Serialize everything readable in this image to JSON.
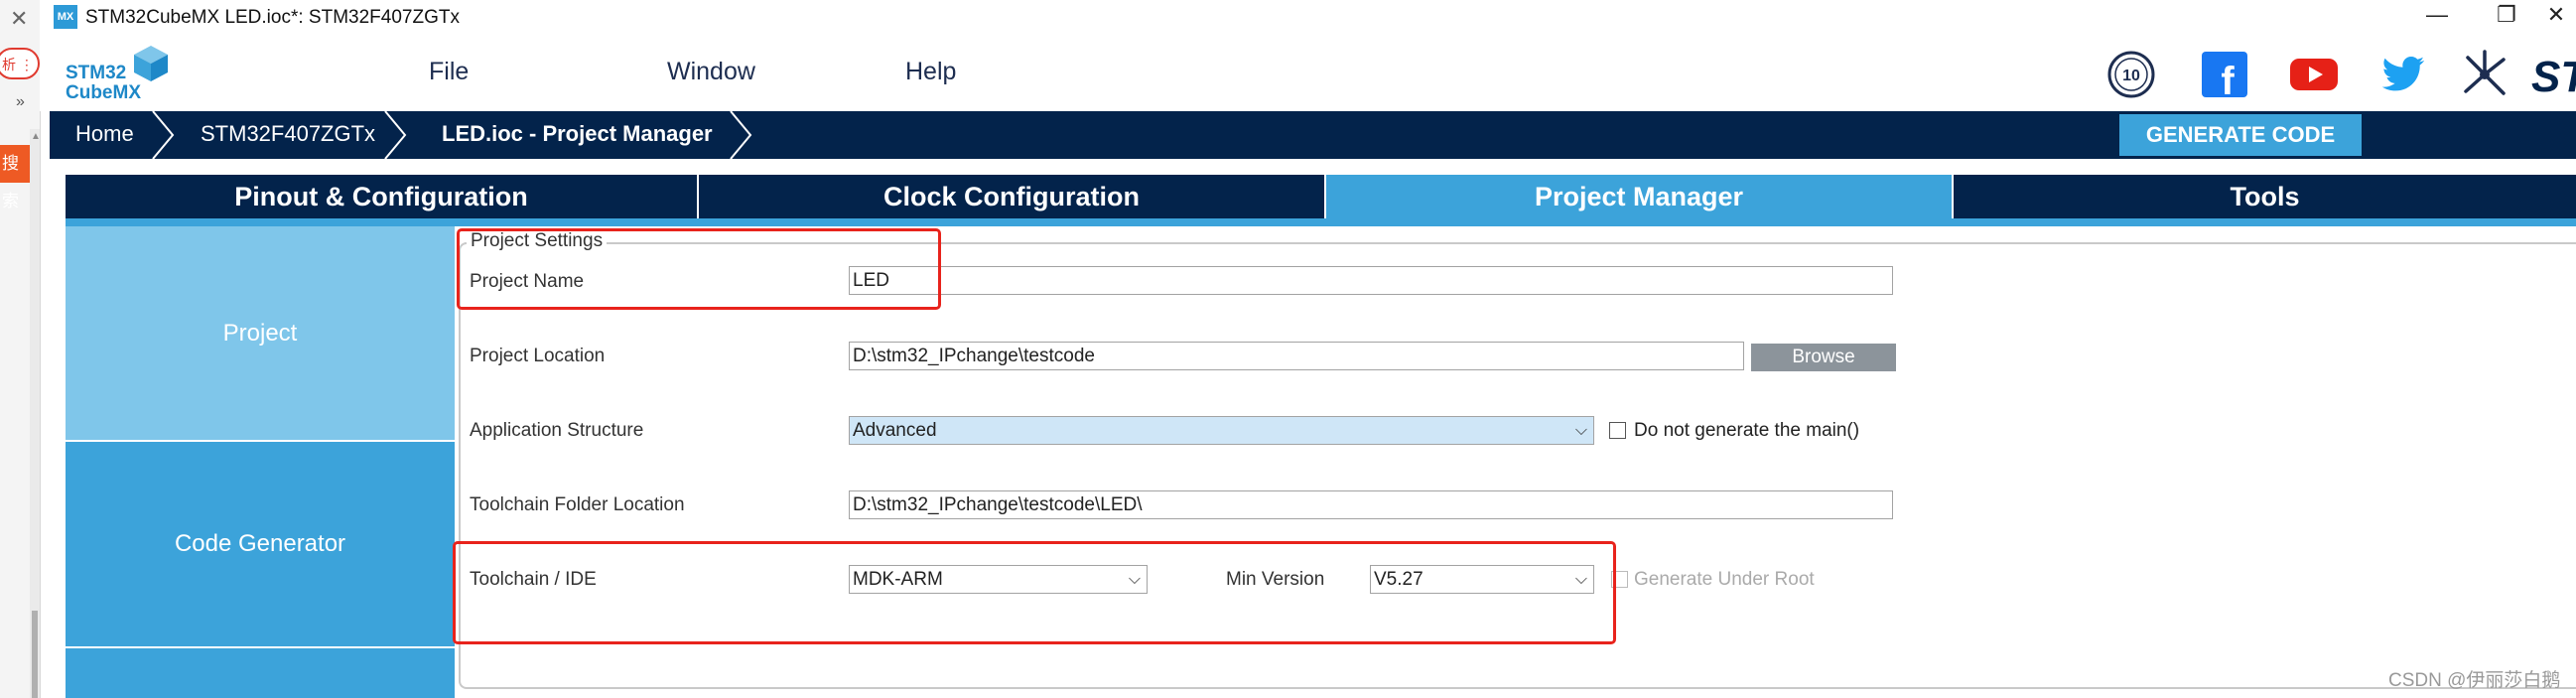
{
  "left_strip": {
    "close_glyph": "✕",
    "pill_text": "析 ⋮",
    "chevron_glyph": "»",
    "search_button": "搜索",
    "scroll_up_glyph": "▲"
  },
  "window": {
    "icon_text": "MX",
    "title": "STM32CubeMX LED.ioc*: STM32F407ZGTx",
    "minimize_glyph": "—",
    "restore_glyph": "❐",
    "close_glyph": "✕"
  },
  "logo": {
    "line1": "STM32",
    "line2": "CubeMX"
  },
  "menu": [
    {
      "label": "File"
    },
    {
      "label": "Window"
    },
    {
      "label": "Help"
    }
  ],
  "social_icons": [
    "anniversary-10-icon",
    "facebook-icon",
    "youtube-icon",
    "twitter-icon",
    "network-icon",
    "st-logo-icon"
  ],
  "social_text": {
    "badge": "10",
    "facebook": "f",
    "st": "ST"
  },
  "breadcrumb": [
    {
      "label": "Home"
    },
    {
      "label": "STM32F407ZGTx"
    },
    {
      "label": "LED.ioc - Project Manager"
    }
  ],
  "generate_button": "GENERATE CODE",
  "tabs": [
    {
      "label": "Pinout & Configuration",
      "active": false
    },
    {
      "label": "Clock Configuration",
      "active": false
    },
    {
      "label": "Project Manager",
      "active": true
    },
    {
      "label": "Tools",
      "active": false
    }
  ],
  "nav": [
    {
      "label": "Project"
    },
    {
      "label": "Code Generator"
    }
  ],
  "project_settings": {
    "legend": "Project Settings",
    "project_name_label": "Project Name",
    "project_name_value": "LED",
    "location_label": "Project Location",
    "location_value": "D:\\stm32_IPchange\\testcode",
    "browse_label": "Browse",
    "app_structure_label": "Application Structure",
    "app_structure_value": "Advanced",
    "no_main_label": "Do not generate the main()",
    "toolchain_folder_label": "Toolchain Folder Location",
    "toolchain_folder_value": "D:\\stm32_IPchange\\testcode\\LED\\",
    "toolchain_label": "Toolchain / IDE",
    "toolchain_value": "MDK-ARM",
    "min_version_label": "Min Version",
    "min_version_value": "V5.27",
    "under_root_label": "Generate Under Root"
  },
  "dropdown_glyph": "⌵",
  "watermark": "CSDN @伊丽莎白鹅",
  "colors": {
    "navy": "#03234b",
    "accent_blue": "#3ca3da",
    "light_blue": "#7fc6ea",
    "highlight_red": "#e8231c"
  }
}
